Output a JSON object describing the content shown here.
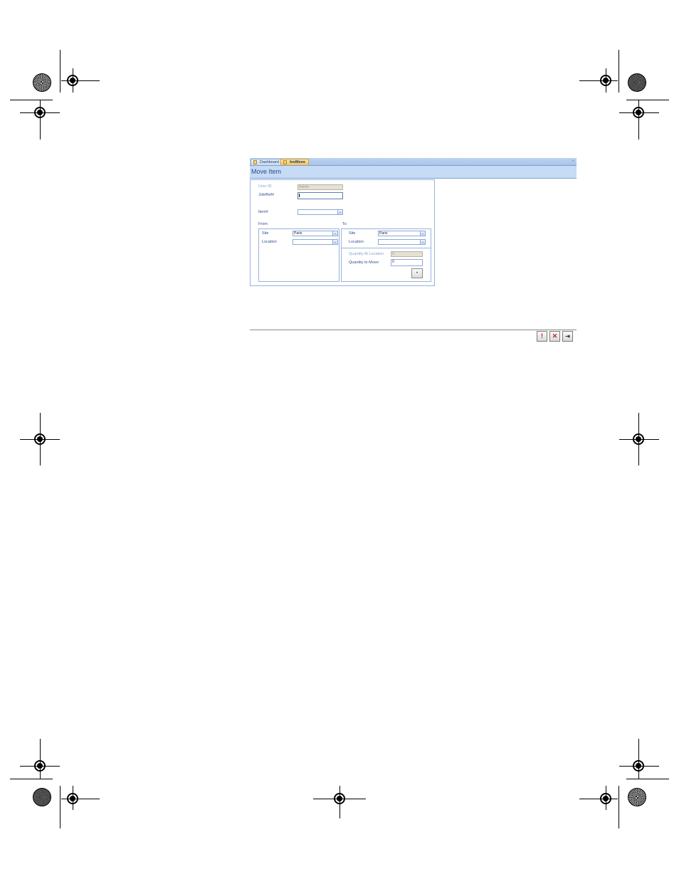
{
  "tabs": [
    {
      "label": "Dashboard",
      "icon": "form-icon"
    },
    {
      "label": "InvMove",
      "icon": "form-icon",
      "active": true
    }
  ],
  "close_glyph": "×",
  "form": {
    "title": "Move Item",
    "user_id": {
      "label": "User ID",
      "value": "Admin"
    },
    "job_ref": {
      "label": "Job/Ref#",
      "value": ""
    },
    "item": {
      "label": "Item#",
      "value": ""
    },
    "from": {
      "label": "From",
      "site": {
        "label": "Site",
        "value": "Paris"
      },
      "location": {
        "label": "Location",
        "value": ""
      }
    },
    "to": {
      "label": "To",
      "site": {
        "label": "Site",
        "value": "Paris"
      },
      "location": {
        "label": "Location",
        "value": ""
      },
      "qty_at_location": {
        "label": "Quantity At Location",
        "value": "0"
      },
      "qty_to_move": {
        "label": "Quantity to Move:",
        "value": "0"
      }
    },
    "go_glyph": "•"
  },
  "footer": {
    "exclaim_glyph": "!",
    "cancel_glyph": "✕",
    "exit_glyph": "⇥"
  },
  "colors": {
    "accent": "#c6dbf5",
    "active_tab": "#f6c25a",
    "border": "#97b3dd"
  }
}
